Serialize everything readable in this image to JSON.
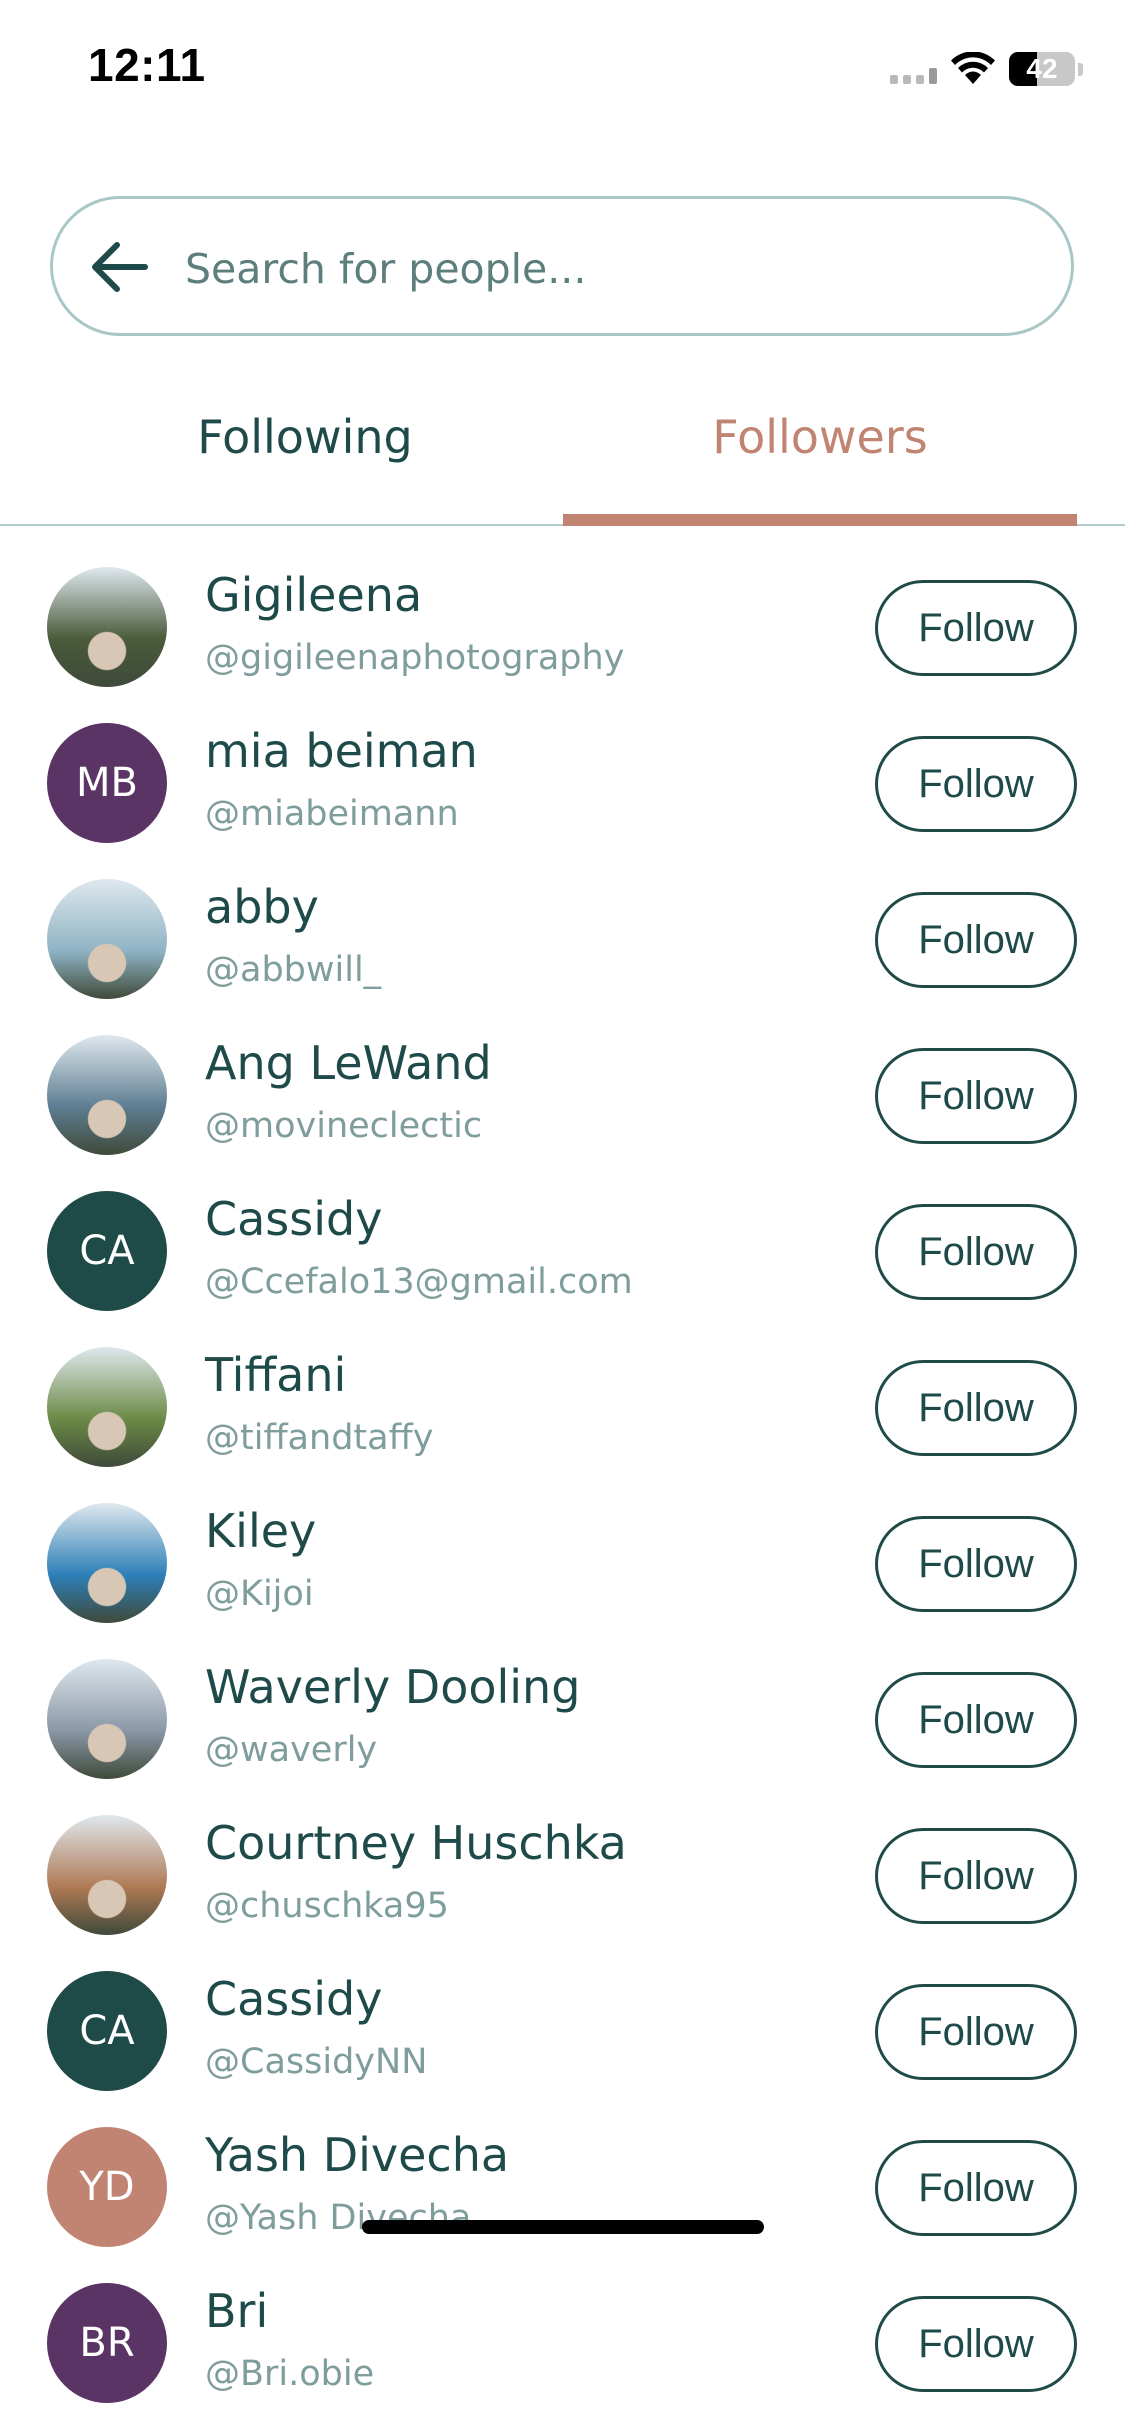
{
  "status_bar": {
    "time": "12:11",
    "battery_percent": "42",
    "battery_level": 0.42
  },
  "search": {
    "placeholder": "Search for people...",
    "value": ""
  },
  "tabs": [
    {
      "label": "Following",
      "active": false
    },
    {
      "label": "Followers",
      "active": true
    }
  ],
  "colors": {
    "primary": "#1f4a4a",
    "accent": "#c28472",
    "muted": "#7f9d9c",
    "border": "#a9c7c6"
  },
  "followers": [
    {
      "name": "Gigileena",
      "handle": "@gigileenaphotography",
      "initials": "",
      "avatar_color": "#4a5a3a",
      "button": "Follow"
    },
    {
      "name": "mia beiman",
      "handle": "@miabeimann",
      "initials": "MB",
      "avatar_color": "#5b3466",
      "button": "Follow"
    },
    {
      "name": "abby",
      "handle": "@abbwill_",
      "initials": "",
      "avatar_color": "#8fb3c4",
      "button": "Follow"
    },
    {
      "name": "Ang LeWand",
      "handle": "@movineclectic",
      "initials": "",
      "avatar_color": "#5e7d92",
      "button": "Follow"
    },
    {
      "name": "Cassidy",
      "handle": "@Ccefalo13@gmail.com",
      "initials": "CA",
      "avatar_color": "#1e4a48",
      "button": "Follow"
    },
    {
      "name": "Tiffani",
      "handle": "@tiffandtaffy",
      "initials": "",
      "avatar_color": "#6b8a46",
      "button": "Follow"
    },
    {
      "name": "Kiley",
      "handle": "@Kijoi",
      "initials": "",
      "avatar_color": "#2d7fb8",
      "button": "Follow"
    },
    {
      "name": "Waverly Dooling",
      "handle": "@waverly",
      "initials": "",
      "avatar_color": "#8a97a6",
      "button": "Follow"
    },
    {
      "name": "Courtney Huschka",
      "handle": "@chuschka95",
      "initials": "",
      "avatar_color": "#b07a55",
      "button": "Follow"
    },
    {
      "name": "Cassidy",
      "handle": "@CassidyNN",
      "initials": "CA",
      "avatar_color": "#1e4a48",
      "button": "Follow"
    },
    {
      "name": "Yash Divecha",
      "handle": "@Yash Divecha",
      "initials": "YD",
      "avatar_color": "#c28472",
      "button": "Follow"
    },
    {
      "name": "Bri",
      "handle": "@Bri.obie",
      "initials": "BR",
      "avatar_color": "#5b3466",
      "button": "Follow"
    }
  ]
}
